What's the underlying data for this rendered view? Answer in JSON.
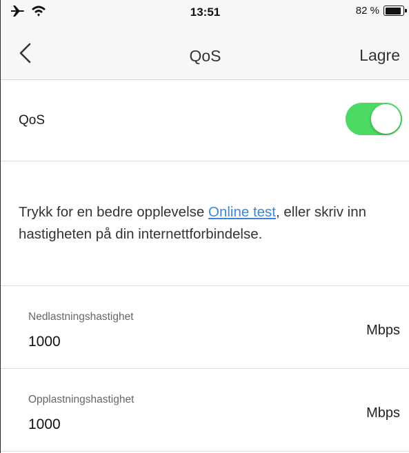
{
  "status_bar": {
    "time": "13:51",
    "battery_percent_text": "82 %",
    "battery_level": 0.82,
    "icons": [
      "airplane-icon",
      "wifi-icon",
      "battery-icon"
    ]
  },
  "nav": {
    "title": "QoS",
    "save_label": "Lagre",
    "back_icon": "chevron-left-icon"
  },
  "qos": {
    "label": "QoS",
    "enabled": true,
    "toggle_color": "#4cd964"
  },
  "info": {
    "text_before": "Trykk for en bedre opplevelse ",
    "link_text": "Online test",
    "text_after": ", eller skriv inn hastigheten på din internettforbindelse.",
    "link_color": "#3a86d4"
  },
  "download": {
    "label": "Nedlastningshastighet",
    "value": "1000",
    "unit": "Mbps"
  },
  "upload": {
    "label": "Opplastningshastighet",
    "value": "1000",
    "unit": "Mbps"
  }
}
